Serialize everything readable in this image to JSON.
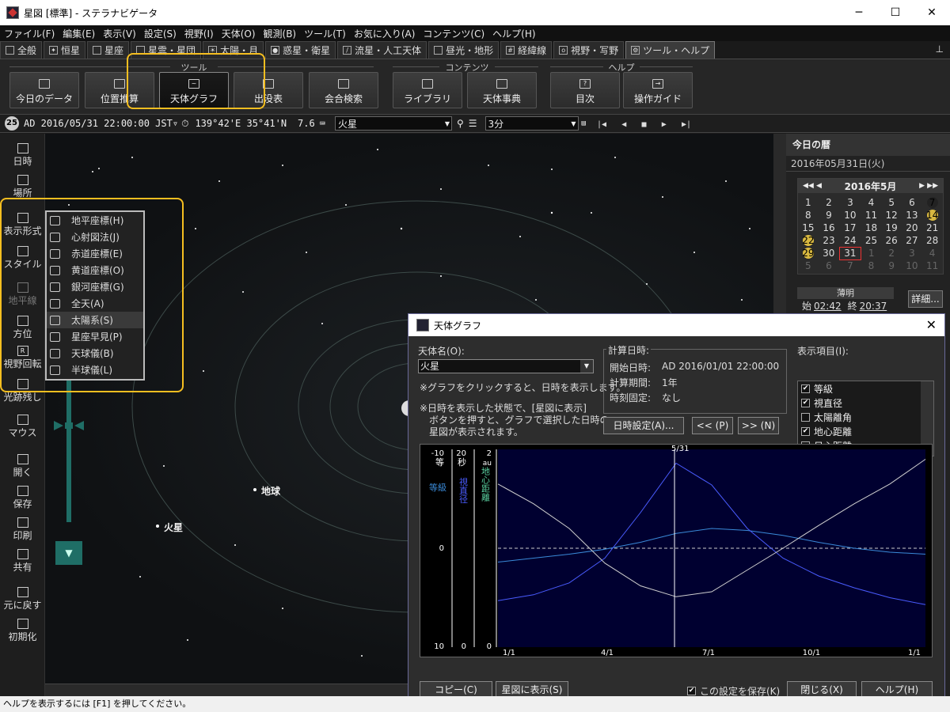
{
  "window": {
    "title": "星図 [標準] - ステラナビゲータ",
    "min": "─",
    "max": "☐",
    "close": "✕"
  },
  "menu": [
    "ファイル(F)",
    "編集(E)",
    "表示(V)",
    "設定(S)",
    "視野(I)",
    "天体(O)",
    "観測(B)",
    "ツール(T)",
    "お気に入り(A)",
    "コンテンツ(C)",
    "ヘルプ(H)"
  ],
  "tabs": [
    "全般",
    "恒星",
    "星座",
    "星雲・星団",
    "太陽・月",
    "惑星・衛星",
    "流星・人工天体",
    "昼光・地形",
    "経緯線",
    "視野・写野",
    "ツール・ヘルプ"
  ],
  "ribbon": {
    "groups": {
      "tool": "ツール",
      "contents": "コンテンツ",
      "help": "ヘルプ"
    },
    "buttons": [
      "今日のデータ",
      "位置推算",
      "天体グラフ",
      "出没表",
      "会合検索",
      "ライブラリ",
      "天体事典",
      "目次",
      "操作ガイド"
    ]
  },
  "status": {
    "day_badge": "25",
    "datetime": "AD 2016/05/31 22:00:00 JST▿",
    "location": "139°42'E 35°41'N",
    "fov": "7.6",
    "object": "火星",
    "step": "3分"
  },
  "sidebar": [
    "日時",
    "場所",
    "表示形式",
    "スタイル",
    "地平線",
    "方位",
    "視野回転",
    "光跡残し",
    "マウス",
    "開く",
    "保存",
    "印刷",
    "共有",
    "元に戻す",
    "初期化"
  ],
  "popup_menu": [
    "地平座標(H)",
    "心射図法(J)",
    "赤道座標(E)",
    "黄道座標(O)",
    "銀河座標(G)",
    "全天(A)",
    "太陽系(S)",
    "星座早見(P)",
    "天球儀(B)",
    "半球儀(L)"
  ],
  "sky_labels": {
    "earth": "地球",
    "mars": "火星"
  },
  "right_panel": {
    "header": "今日の暦",
    "date": "2016年05月31日(火)",
    "month": "2016年5月",
    "nav_prev": "◀◀ ◀",
    "nav_next": "▶ ▶▶",
    "weeks": [
      [
        "1",
        "2",
        "3",
        "4",
        "5",
        "6",
        "7"
      ],
      [
        "8",
        "9",
        "10",
        "11",
        "12",
        "13",
        "14"
      ],
      [
        "15",
        "16",
        "17",
        "18",
        "19",
        "20",
        "21"
      ],
      [
        "22",
        "23",
        "24",
        "25",
        "26",
        "27",
        "28"
      ],
      [
        "29",
        "30",
        "31",
        "1",
        "2",
        "3",
        "4"
      ],
      [
        "5",
        "6",
        "7",
        "8",
        "9",
        "10",
        "11"
      ]
    ],
    "twilight_label": "薄明",
    "start_label": "始",
    "start_time": "02:42",
    "end_label": "終",
    "end_time": "20:37",
    "detail_btn": "詳細..."
  },
  "dialog": {
    "title": "天体グラフ",
    "object_label": "天体名(O):",
    "object_value": "火星",
    "note1": "※グラフをクリックすると、日時を表示します。",
    "note2": "※日時を表示した状態で、[星図に表示]",
    "note3": "ボタンを押すと、グラフで選択した日時の",
    "note4": "星図が表示されます。",
    "calc_label": "計算日時:",
    "start_key": "開始日時:",
    "start_val": "AD 2016/01/01 22:00:00",
    "period_key": "計算期間:",
    "period_val": "1年",
    "fixed_key": "時刻固定:",
    "fixed_val": "なし",
    "btn_datetime": "日時設定(A)...",
    "btn_prev": "<< (P)",
    "btn_next": ">> (N)",
    "items_label": "表示項目(I):",
    "items": [
      {
        "label": "等級",
        "checked": "✔"
      },
      {
        "label": "視直径",
        "checked": "✔"
      },
      {
        "label": "太陽離角",
        "checked": ""
      },
      {
        "label": "地心距離",
        "checked": "✔"
      },
      {
        "label": "日心距離",
        "checked": ""
      }
    ],
    "btn_copy": "コピー(C)",
    "btn_show": "星図に表示(S)",
    "save_setting": "この設定を保存(K)",
    "btn_close": "閉じる(X)",
    "btn_help": "ヘルプ(H)"
  },
  "chart_data": {
    "type": "line",
    "axes": {
      "magnitude": {
        "top": "-10",
        "unit": "等",
        "bottom": "10",
        "mid": "0",
        "label": "等級"
      },
      "diameter": {
        "top": "20",
        "unit": "秒",
        "bottom": "0",
        "label": "視直径"
      },
      "distance": {
        "top": "2",
        "unit": "au",
        "bottom": "0",
        "label": "地心距離"
      }
    },
    "x_ticks": [
      "1/1",
      "4/1",
      "7/1",
      "10/1",
      "1/1"
    ],
    "marker_label": "5/31",
    "marker_pos": 0.413,
    "series": [
      {
        "name": "等級",
        "color": "#3a8ad8",
        "y": [
          1.4,
          1.0,
          0.6,
          0.1,
          -0.6,
          -1.5,
          -2.0,
          -1.8,
          -1.3,
          -0.6,
          0.0,
          0.4,
          0.6
        ]
      },
      {
        "name": "視直径",
        "color": "#4a5cff",
        "y": [
          4.7,
          5.3,
          6.5,
          9.0,
          13.6,
          18.6,
          16.4,
          12.0,
          9.0,
          7.2,
          6.0,
          5.0,
          4.3
        ]
      },
      {
        "name": "地心距離",
        "color": "#d0d0d0",
        "y": [
          1.65,
          1.45,
          1.2,
          0.85,
          0.62,
          0.51,
          0.56,
          0.78,
          1.0,
          1.23,
          1.45,
          1.65,
          1.9
        ]
      }
    ]
  }
}
